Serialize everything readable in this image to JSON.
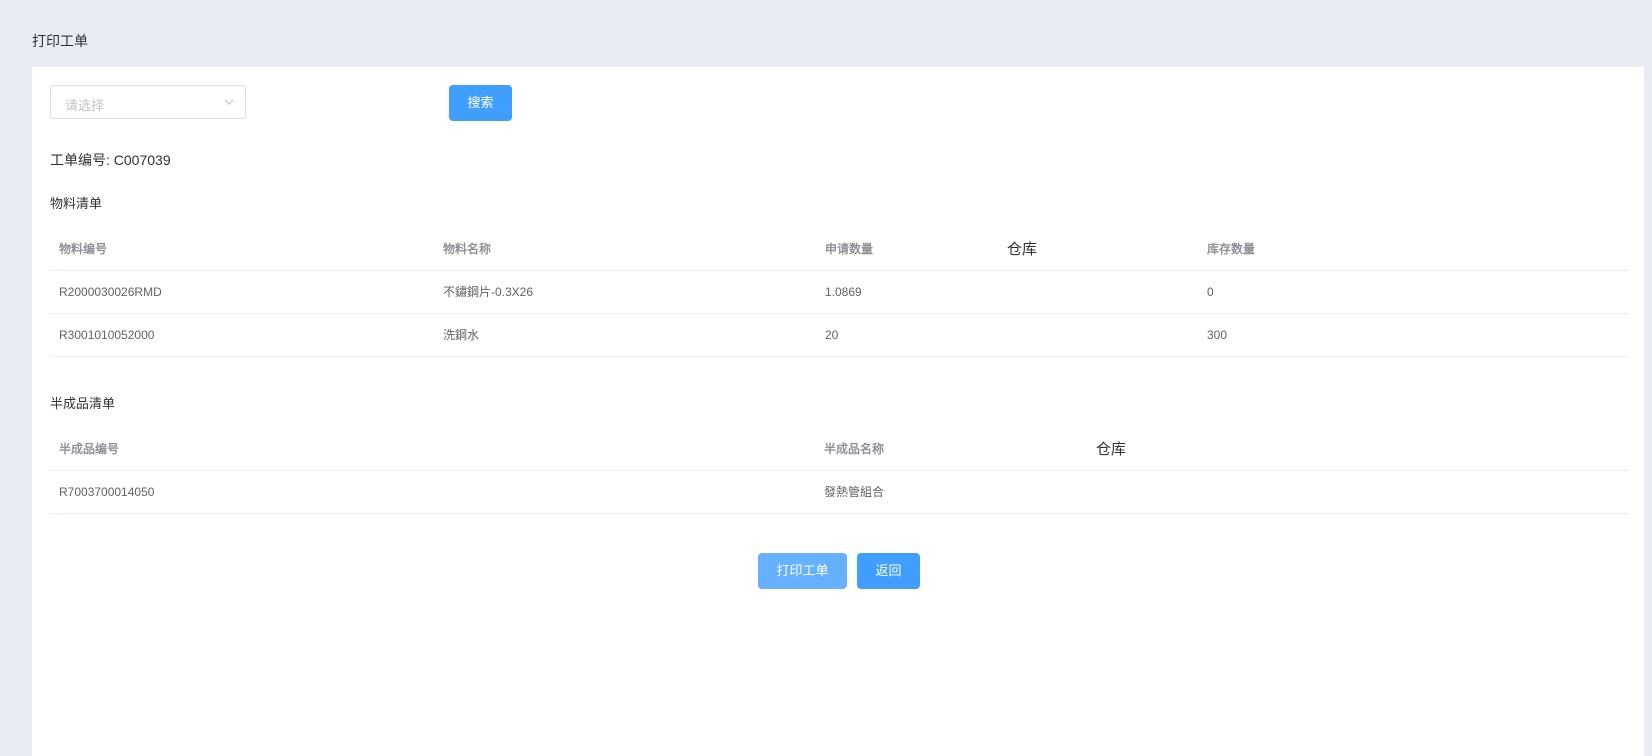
{
  "page": {
    "title": "打印工单"
  },
  "filter": {
    "placeholder": "请选择",
    "search_label": "搜索"
  },
  "order": {
    "label": "工单编号: C007039"
  },
  "materials": {
    "title": "物料清单",
    "headers": [
      "物料编号",
      "物料名称",
      "申请数量",
      "仓库",
      "库存数量"
    ],
    "rows": [
      [
        "R2000030026RMD",
        "不鏽鋼片-0.3X26",
        "1.0869",
        "",
        "0"
      ],
      [
        "R3001010052000",
        "洗鋼水",
        "20",
        "",
        "300"
      ]
    ]
  },
  "semi": {
    "title": "半成品清单",
    "headers": [
      "半成品编号",
      "半成品名称",
      "仓库"
    ],
    "rows": [
      [
        "R7003700014050",
        "發熱管組合",
        ""
      ]
    ]
  },
  "actions": {
    "print_label": "打印工单",
    "back_label": "返回"
  },
  "colors": {
    "primary": "#409eff",
    "primary_light": "#66b1ff",
    "background": "#e9edf3"
  }
}
